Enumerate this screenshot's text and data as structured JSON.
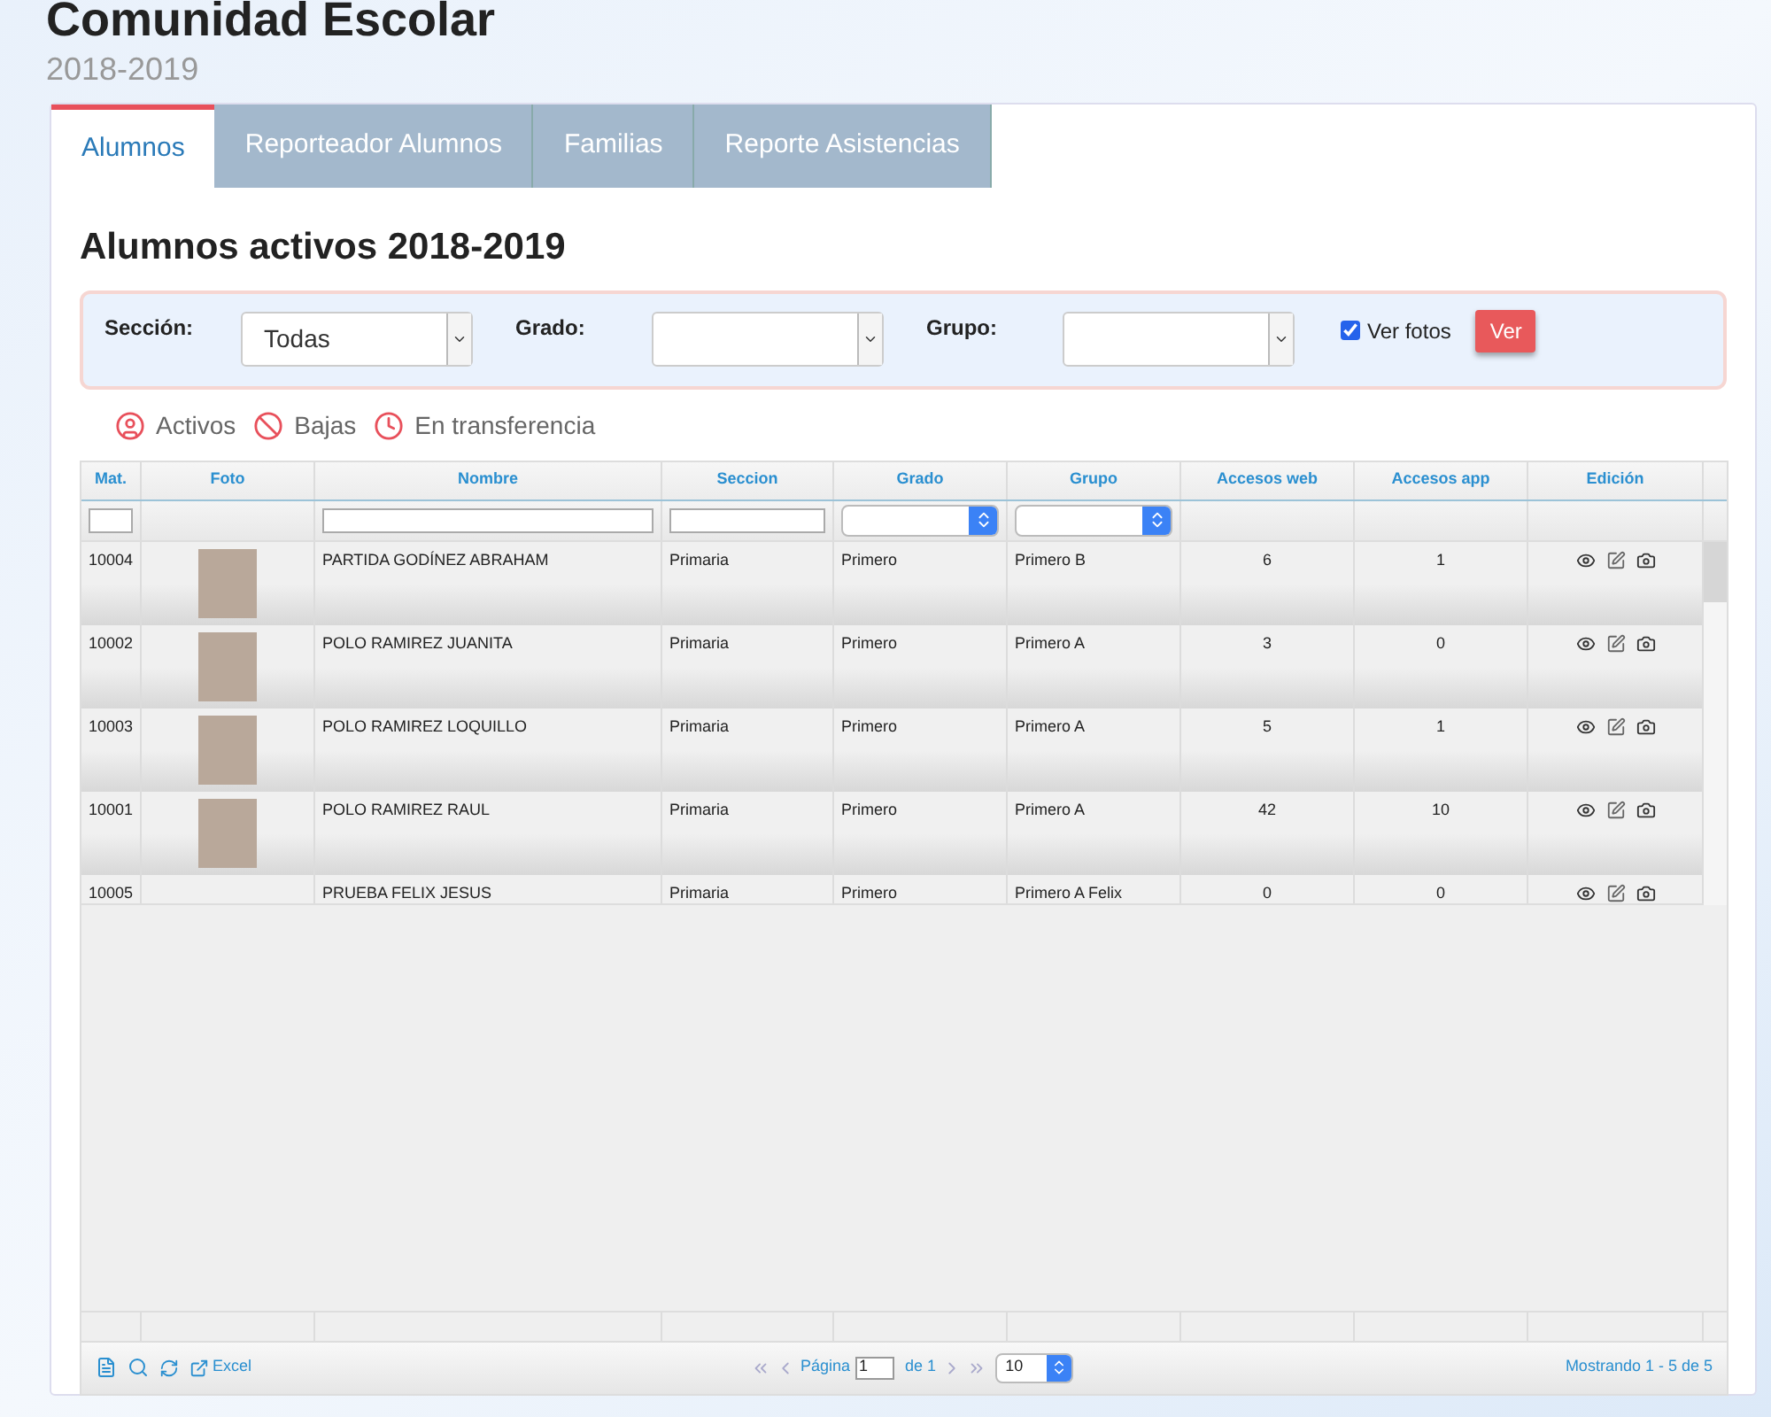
{
  "header": {
    "title": "Comunidad Escolar",
    "subtitle": "2018-2019"
  },
  "tabs": [
    {
      "label": "Alumnos",
      "selected": true
    },
    {
      "label": "Reporteador Alumnos",
      "selected": false
    },
    {
      "label": "Familias",
      "selected": false
    },
    {
      "label": "Reporte Asistencias",
      "selected": false
    }
  ],
  "heading": "Alumnos activos 2018-2019",
  "filters": [
    {
      "label": "Sección:",
      "value": "Todas"
    },
    {
      "label": "Grado:"
    },
    {
      "label": "Grupo:"
    }
  ],
  "ver_fotos": {
    "label": "Ver fotos",
    "checked": true
  },
  "ver_button": "Ver",
  "legend": [
    {
      "kind": "user",
      "label": "Activos"
    },
    {
      "kind": "ban",
      "label": "Bajas"
    },
    {
      "kind": "clock",
      "label": "En transferencia"
    }
  ],
  "table": {
    "columns": [
      {
        "label": "Mat.",
        "filter": {
          "kind": "text"
        }
      },
      {
        "label": "Foto"
      },
      {
        "label": "Nombre",
        "filter": {
          "kind": "text"
        }
      },
      {
        "label": "Seccion",
        "filter": {
          "kind": "text"
        }
      },
      {
        "label": "Grado",
        "filter": {
          "kind": "select"
        }
      },
      {
        "label": "Grupo",
        "filter": {
          "kind": "select"
        }
      },
      {
        "label": "Accesos web"
      },
      {
        "label": "Accesos app"
      },
      {
        "label": "Edición"
      }
    ],
    "rows": [
      {
        "mat": "10004",
        "photo": true,
        "nombre": "PARTIDA GODÍNEZ ABRAHAM",
        "seccion": "Primaria",
        "grado": "Primero",
        "grupo": "Primero B",
        "web": "6",
        "app": "1"
      },
      {
        "mat": "10002",
        "photo": true,
        "nombre": "POLO RAMIREZ JUANITA",
        "seccion": "Primaria",
        "grado": "Primero",
        "grupo": "Primero A",
        "web": "3",
        "app": "0"
      },
      {
        "mat": "10003",
        "photo": true,
        "nombre": "POLO RAMIREZ LOQUILLO",
        "seccion": "Primaria",
        "grado": "Primero",
        "grupo": "Primero A",
        "web": "5",
        "app": "1"
      },
      {
        "mat": "10001",
        "photo": true,
        "nombre": "POLO RAMIREZ RAUL",
        "seccion": "Primaria",
        "grado": "Primero",
        "grupo": "Primero A",
        "web": "42",
        "app": "10"
      },
      {
        "mat": "10005",
        "photo": false,
        "nombre": "PRUEBA FELIX JESUS",
        "seccion": "Primaria",
        "grado": "Primero",
        "grupo": "Primero A Felix",
        "web": "0",
        "app": "0"
      }
    ]
  },
  "pager": {
    "excel": "Excel",
    "page_label": "Página",
    "page": "1",
    "of": "de 1",
    "per_page": "10",
    "showing": "Mostrando 1 - 5 de 5"
  }
}
